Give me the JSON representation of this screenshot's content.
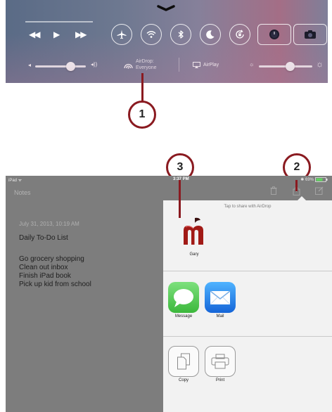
{
  "control_center": {
    "airdrop": {
      "label": "AirDrop:",
      "value": "Everyone"
    },
    "airplay_label": "AirPlay",
    "volume_level": 0.7,
    "brightness_level": 0.58
  },
  "callouts": [
    "1",
    "2",
    "3"
  ],
  "ipad": {
    "status": {
      "carrier": "iPad ᯤ",
      "time": "3:37 PM",
      "battery": "✱ 69%"
    },
    "notes_title": "Notes",
    "note": {
      "date": "July 31, 2013, 10:19 AM",
      "heading": "Daily To-Do List",
      "items": [
        "Go grocery shopping",
        "Clean out inbox",
        "Finish iPad book",
        "Pick up kid from school"
      ]
    },
    "share_sheet": {
      "hint": "Tap to share with AirDrop",
      "airdrop_contact": "Gary",
      "apps": [
        "Message",
        "Mail"
      ],
      "actions": [
        "Copy",
        "Print"
      ]
    }
  },
  "colors": {
    "callout": "#8a1a20",
    "message_green": "#4cd964",
    "mail_blue": "#1b8cf0"
  }
}
